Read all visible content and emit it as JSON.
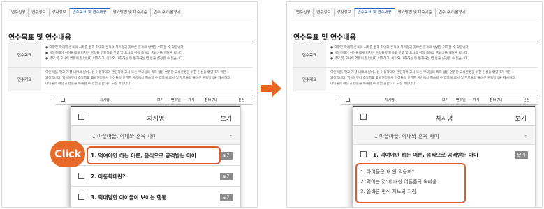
{
  "tabs": [
    "연수신청",
    "연수정보",
    "강사정보",
    "연수목표 및 연수내용",
    "평가방법 및 이수기준",
    "연수 후기/활용기"
  ],
  "active_tab_index": 3,
  "page_title": "연수목표 및 연수내용",
  "goal": {
    "label": "연수목표",
    "lines": [
      "● 다양한 학대와 훈육의 사례를 통해 학대와 훈육의 차이점과 올바른 훈육의 방법을 이해할 수 있습니다.",
      "● 아동학대가 아이들에게 미치는 영향을 파악하고 부모 및 교사의 감정 조절의 중요성을 깨달게 됩니다.",
      "● 부모 및 교사의 역할이 무엇인지 이해하고, 아이와 대화하는 등 통해하는 법 등을 실천할 수 있습니다."
    ]
  },
  "summary": {
    "label": "연수개요",
    "lines": [
      "어린이집, 학교 가정 내에서 일어나는 아동학대와 관련하여 교사 또는 부모들의 특히 없는 안전한 교육환경을 위한 인성을 함양하기 위한",
      "과정입니다. 영유아부터 초등학교 교육현장에서 아이들이 안전한 환경에서 학습할 수 있도록 교사 및 부모들의 올바른 훈육방법을 제시하고,",
      "아이들의 마음과 행동을 이해할 수 있는 길잡이가 되길 바랍니다."
    ]
  },
  "mini_table": {
    "headers": [
      "차시명",
      "보기",
      "연수일",
      "가격",
      "정바구니",
      "신청"
    ]
  },
  "card": {
    "header_name": "차시명",
    "header_view": "보기",
    "row1": {
      "name": "1 아슬아슬, 학대와 훈육 사이",
      "view": "-"
    },
    "rows_left": [
      {
        "name": "1. 먹여야만 하는 어른, 음식으로 공격받는 아이",
        "btn": "보기"
      },
      {
        "name": "2. 아동학대란?",
        "btn": "보기"
      },
      {
        "name": "3. 학대당한 아이들이 보이는 행동",
        "btn": "보기"
      }
    ],
    "row_right": {
      "name": "1. 먹여야만 하는 어른, 음식으로 공격받는 아이",
      "btn": "닫기"
    },
    "expanded": [
      "1. 아이들은 왜 안 먹을까?",
      "2.'먹이는 것'에 대한 어른들의 속마음",
      "3. 올바른 편식 지도의 지침"
    ]
  },
  "click_label": "Click",
  "colors": {
    "accent": "#e05a2c",
    "badge": "#e86a2a",
    "tab_active": "#2166c6"
  },
  "icons": [
    "arrow-right-icon",
    "checkbox-icon"
  ]
}
